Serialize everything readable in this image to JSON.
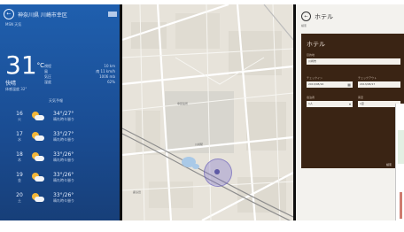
{
  "weather": {
    "city": "神奈川県 川崎市幸区",
    "sub": "MSN 天気",
    "temperature": "31",
    "unit": "°C",
    "condition": "快晴",
    "condition_sub": "体感温度 32°",
    "details": [
      {
        "k": "視程",
        "v": "10 km"
      },
      {
        "k": "風",
        "v": "南 11 km/h"
      },
      {
        "k": "気圧",
        "v": "1006 mb"
      },
      {
        "k": "湿度",
        "v": "62%"
      }
    ],
    "forecast_title": "天気予報",
    "forecast": [
      {
        "date": "16",
        "weekday": "火",
        "temp": "34°/27°",
        "cond": "晴れ時々曇り"
      },
      {
        "date": "17",
        "weekday": "水",
        "temp": "33°/27°",
        "cond": "晴れ時々曇り"
      },
      {
        "date": "18",
        "weekday": "木",
        "temp": "33°/26°",
        "cond": "晴れ時々曇り"
      },
      {
        "date": "19",
        "weekday": "金",
        "temp": "33°/26°",
        "cond": "晴れ時々曇り"
      },
      {
        "date": "20",
        "weekday": "土",
        "temp": "33°/26°",
        "cond": "晴れ時々曇り"
      }
    ],
    "colors": {
      "panel": "#1f5fae",
      "sun": "#f3b73a"
    }
  },
  "map": {
    "labels": [
      "川崎駅",
      "幸区役所",
      "鹿島田"
    ],
    "location_marker": "current-location-icon"
  },
  "hotel": {
    "title": "ホテル",
    "sub": "検索",
    "form_title": "ホテル",
    "fields": {
      "destination_label": "目的地",
      "destination_value": "川崎市",
      "checkin_label": "チェックイン",
      "checkin_value": "2013/08/16",
      "checkout_label": "チェックアウト",
      "checkout_value": "2013/08/17",
      "guests_label": "宿泊者",
      "guests_value": "1人",
      "rooms_label": "客室",
      "rooms_value": "1室"
    },
    "search_label": "検索",
    "colors": {
      "form": "#3a2414"
    }
  }
}
